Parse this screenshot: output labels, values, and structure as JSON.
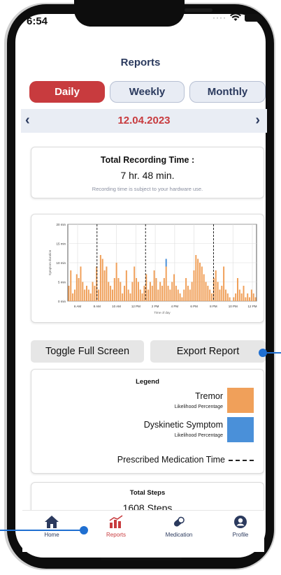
{
  "status": {
    "time": "6:54"
  },
  "header": {
    "title": "Reports"
  },
  "tabs": {
    "daily": "Daily",
    "weekly": "Weekly",
    "monthly": "Monthly",
    "active": "Daily"
  },
  "date_nav": {
    "date": "12.04.2023",
    "prev_icon": "chevron-left-icon",
    "next_icon": "chevron-right-icon"
  },
  "recording": {
    "title": "Total Recording Time :",
    "value": "7 hr. 48 min.",
    "note": "Recording time is subject to your hardware use."
  },
  "chart_data": {
    "type": "bar",
    "ylabel": "Symptom duration",
    "xlabel": "Time of day",
    "y_ticks": [
      "0 min",
      "5 min",
      "10 min",
      "15 min",
      "20 min"
    ],
    "ylim": [
      0,
      20
    ],
    "x_ticks": [
      "6 AM",
      "8 AM",
      "10 AM",
      "12 PM",
      "2 PM",
      "4 PM",
      "6 PM",
      "8 PM",
      "10 PM",
      "12 PM"
    ],
    "grid": true,
    "medication_markers": [
      "8 AM",
      "1 PM",
      "8 PM"
    ],
    "series": [
      {
        "name": "Tremor",
        "color": "#f0a05a",
        "values": [
          4,
          8,
          2,
          3,
          7,
          6,
          9,
          5,
          3,
          4,
          3,
          2,
          5,
          4,
          9,
          3,
          12,
          11,
          8,
          9,
          5,
          4,
          3,
          6,
          10,
          6,
          5,
          2,
          4,
          8,
          3,
          2,
          5,
          9,
          6,
          5,
          3,
          2,
          4,
          7,
          3,
          5,
          4,
          8,
          6,
          3,
          5,
          4,
          6,
          9,
          4,
          3,
          5,
          7,
          4,
          3,
          2,
          1,
          3,
          6,
          4,
          3,
          5,
          8,
          12,
          11,
          10,
          9,
          7,
          5,
          4,
          3,
          2,
          6,
          8,
          5,
          3,
          4,
          9,
          3,
          2,
          1,
          0,
          1,
          2,
          6,
          3,
          2,
          4,
          1,
          2,
          1,
          3,
          2,
          1
        ]
      },
      {
        "name": "Dyskinetic Symptom",
        "color": "#4a90d9",
        "values": [
          0,
          0,
          0,
          0,
          0,
          0,
          0,
          0,
          0,
          0,
          0,
          0,
          0,
          0,
          0,
          0,
          0,
          0,
          0,
          0,
          0,
          0,
          0,
          0,
          0,
          0,
          0,
          0,
          0,
          0,
          0,
          0,
          0,
          0,
          0,
          0,
          0,
          0,
          0,
          0,
          0,
          0,
          0,
          0,
          0,
          0,
          0,
          0,
          0,
          2,
          0,
          0,
          0,
          0,
          0,
          0,
          0,
          0,
          0,
          0,
          0,
          0,
          0,
          0,
          0,
          0,
          0,
          0,
          0,
          0,
          0,
          0,
          0,
          0,
          0,
          0,
          0,
          0,
          0,
          0,
          0,
          0,
          0,
          0,
          0,
          0,
          0,
          0,
          0,
          0,
          0,
          0,
          0,
          0,
          0
        ]
      }
    ]
  },
  "actions": {
    "toggle_fullscreen": "Toggle Full Screen",
    "export_report": "Export Report"
  },
  "legend": {
    "title": "Legend",
    "tremor": "Tremor",
    "tremor_sub": "Likelihood Percentage",
    "tremor_color": "#f0a05a",
    "dysk": "Dyskinetic Symptom",
    "dysk_sub": "Likelihood Percentage",
    "dysk_color": "#4a90d9",
    "medication": "Prescribed Medication Time"
  },
  "steps": {
    "title": "Total Steps",
    "value": "1608 Steps"
  },
  "tabbar": {
    "home": "Home",
    "reports": "Reports",
    "medication": "Medication",
    "profile": "Profile"
  },
  "colors": {
    "accent": "#c83b3e",
    "navy": "#2b3a5e",
    "callout": "#1f6fd1"
  }
}
